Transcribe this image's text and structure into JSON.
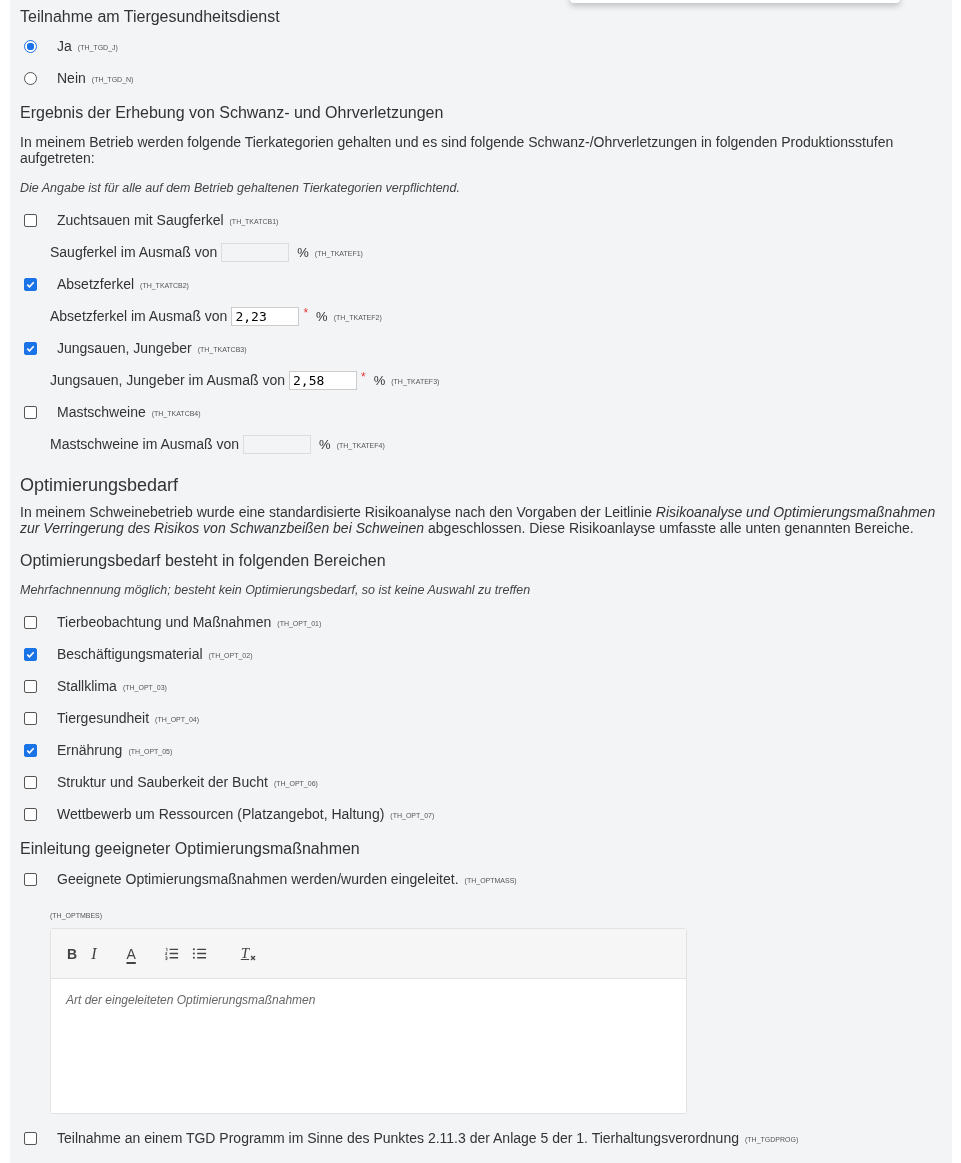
{
  "participation": {
    "heading": "Teilnahme am Tiergesundheitsdienst",
    "options": [
      {
        "label": "Ja",
        "code": "(TH_TGD_J)",
        "selected": true
      },
      {
        "label": "Nein",
        "code": "(TH_TGD_N)",
        "selected": false
      }
    ]
  },
  "injuries": {
    "heading": "Ergebnis der Erhebung von Schwanz- und Ohrverletzungen",
    "intro": "In meinem Betrieb werden folgende Tierkategorien gehalten und es sind folgende Schwanz-/Ohrverletzungen in folgenden Produktionsstufen aufgetreten:",
    "note": "Die Angabe ist für alle auf dem Betrieb gehaltenen Tierkategorien verpflichtend.",
    "categories": [
      {
        "label": "Zuchtsauen mit Saugferkel",
        "code": "(TH_TKATCB1)",
        "checked": false,
        "amount_label": "Saugferkel im Ausmaß von",
        "unit": "%",
        "amount_code": "(TH_TKATEF1)"
      },
      {
        "label": "Absetzferkel",
        "code": "(TH_TKATCB2)",
        "checked": true,
        "amount_label": "Absetzferkel im Ausmaß von",
        "value": "2,23",
        "required_mark": "*",
        "unit": "%",
        "amount_code": "(TH_TKATEF2)"
      },
      {
        "label": "Jungsauen, Jungeber",
        "code": "(TH_TKATCB3)",
        "checked": true,
        "amount_label": "Jungsauen, Jungeber im Ausmaß von",
        "value": "2,58",
        "required_mark": "*",
        "unit": "%",
        "amount_code": "(TH_TKATEF3)"
      },
      {
        "label": "Mastschweine",
        "code": "(TH_TKATCB4)",
        "checked": false,
        "amount_label": "Mastschweine im Ausmaß von",
        "unit": "%",
        "amount_code": "(TH_TKATEF4)"
      }
    ]
  },
  "optimization": {
    "heading": "Optimierungsbedarf",
    "text": "In meinem Schweinebetrieb wurde eine standardisierte Risikoanalyse nach den Vorgaben der Leitlinie *Risikoanalyse und Optimierungsmaßnahmen zur Verringerung des Risikos von Schwanzbeißen bei Schweinen* abgeschlossen. Diese Risikoanlayse umfasste alle unten genannten Bereiche."
  },
  "areas": {
    "heading": "Optimierungsbedarf besteht in folgenden Bereichen",
    "note": "Mehrfachnennung möglich; besteht kein Optimierungsbedarf, so ist keine Auswahl zu treffen",
    "options": [
      {
        "label": "Tierbeobachtung und Maßnahmen",
        "code": "(TH_OPT_01)",
        "checked": false
      },
      {
        "label": "Beschäftigungsmaterial",
        "code": "(TH_OPT_02)",
        "checked": true
      },
      {
        "label": "Stallklima",
        "code": "(TH_OPT_03)",
        "checked": false
      },
      {
        "label": "Tiergesundheit",
        "code": "(TH_OPT_04)",
        "checked": false
      },
      {
        "label": "Ernährung",
        "code": "(TH_OPT_05)",
        "checked": true
      },
      {
        "label": "Struktur und Sauberkeit der Bucht",
        "code": "(TH_OPT_06)",
        "checked": false
      },
      {
        "label": "Wettbewerb um Ressourcen (Platzangebot, Haltung)",
        "code": "(TH_OPT_07)",
        "checked": false
      }
    ]
  },
  "measures": {
    "heading": "Einleitung geeigneter Optimierungsmaßnahmen",
    "checkbox": {
      "label": "Geeignete Optimierungsmaßnahmen werden/wurden eingeleitet.",
      "code": "(TH_OPTMASS)",
      "checked": false
    },
    "editor_code": "(TH_OPTMBES)",
    "toolbar": [
      {
        "kind": "bold",
        "label": "B"
      },
      {
        "kind": "italic",
        "label": "I"
      },
      {
        "kind": "color",
        "label": "A"
      },
      {
        "kind": "ordered-list"
      },
      {
        "kind": "bullet-list"
      },
      {
        "kind": "clear",
        "label": "T"
      }
    ],
    "placeholder": "Art der eingeleiteten Optimierungsmaßnahmen"
  },
  "program": {
    "label": "Teilnahme an einem TGD Programm im Sinne des Punktes 2.11.3 der Anlage 5 der 1. Tierhaltungsverordnung",
    "code": "(TH_TGDPROG)",
    "checked": false
  }
}
